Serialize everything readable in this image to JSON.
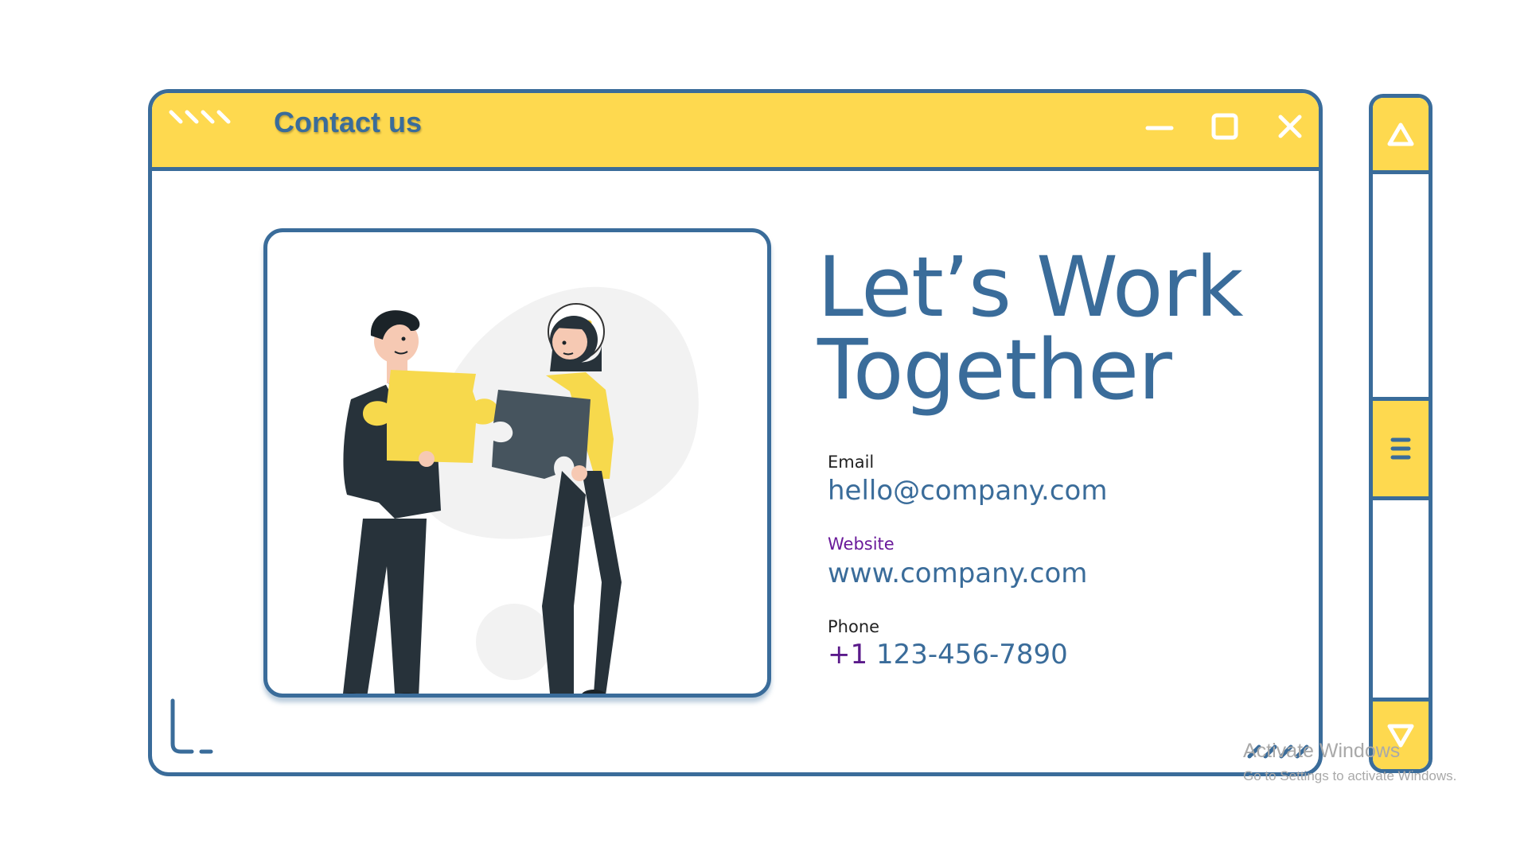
{
  "window": {
    "title": "Contact us",
    "controls": [
      "minimize-icon",
      "maximize-icon",
      "close-icon"
    ]
  },
  "headline": {
    "line1": "Let’s Work",
    "line2": "Together"
  },
  "contact": {
    "email_label": "Email",
    "email_value": "hello@company.com",
    "website_label": "Website",
    "website_value": "www.company.com",
    "phone_label": "Phone",
    "phone_prefix": "+1",
    "phone_number": "123-456-7890"
  },
  "scrollbar": {
    "up_icon": "triangle-up-icon",
    "thumb_icon": "menu-lines-icon",
    "down_icon": "triangle-down-icon"
  },
  "watermark": {
    "line1": "Activate Windows",
    "line2": "Go to Settings to activate Windows."
  },
  "colors": {
    "accent": "#fed94f",
    "primary": "#3a6c9a",
    "website_label": "#6a1a9a",
    "phone_prefix": "#5a1a8a",
    "dark": "#27323a",
    "puzzle_dark": "#46545e"
  }
}
